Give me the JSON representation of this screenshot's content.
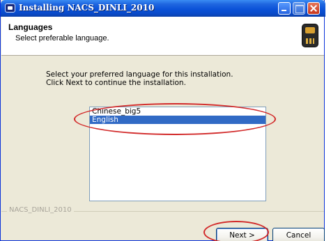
{
  "window": {
    "title": "Installing NACS_DINLI_2010"
  },
  "header": {
    "title": "Languages",
    "subtitle": "Select preferable language."
  },
  "body": {
    "instruction_line1": "Select your preferred language for this installation.",
    "instruction_line2": "Click Next to continue the installation."
  },
  "languages": {
    "items": [
      "Chinese_big5",
      "English"
    ],
    "selected": "English"
  },
  "footer": {
    "group_label": "NACS_DINLI_2010"
  },
  "buttons": {
    "next_label": "Next >",
    "cancel_label": "Cancel"
  },
  "colors": {
    "selection": "#316ac5",
    "annotation": "#d22a2a"
  }
}
